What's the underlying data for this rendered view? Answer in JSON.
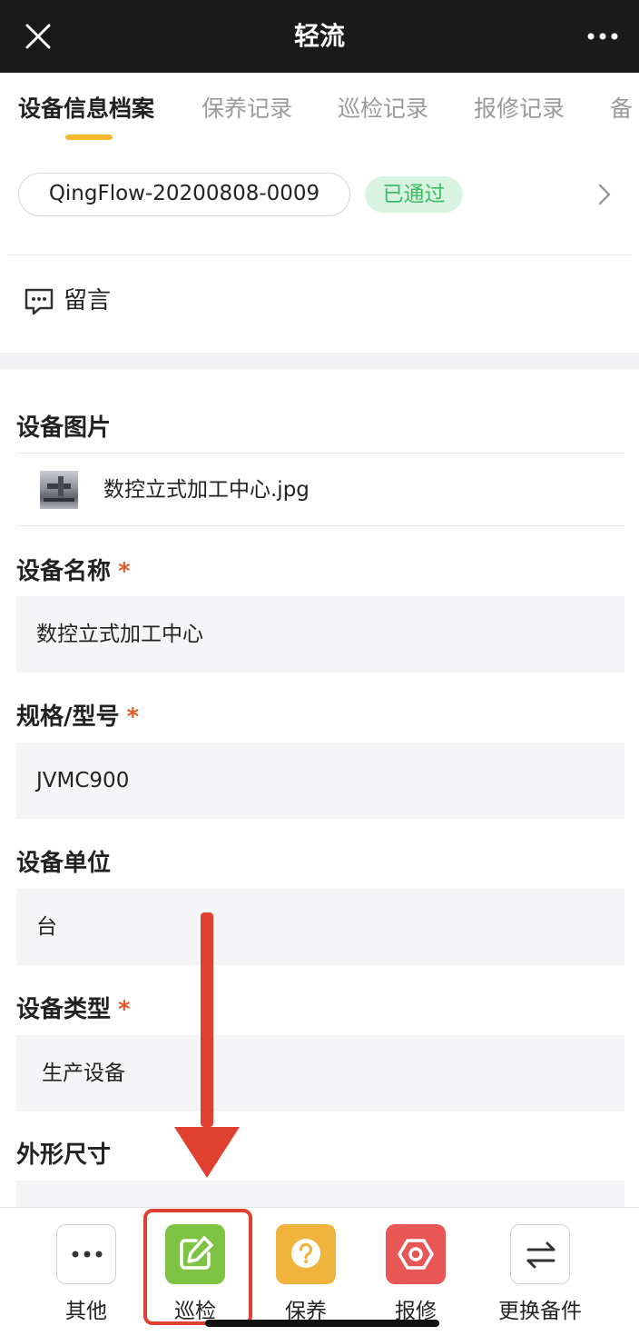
{
  "titlebar": {
    "title": "轻流"
  },
  "tabs": [
    "设备信息档案",
    "保养记录",
    "巡检记录",
    "报修记录",
    "备"
  ],
  "record": {
    "id": "QingFlow-20200808-0009",
    "status": "已通过"
  },
  "comment": {
    "label": "留言"
  },
  "form": {
    "image_label": "设备图片",
    "image_file": "数控立式加工中心.jpg",
    "name_label": "设备名称",
    "name_value": "数控立式加工中心",
    "spec_label": "规格/型号",
    "spec_value": "JVMC900",
    "unit_label": "设备单位",
    "unit_value": "台",
    "type_label": "设备类型",
    "type_value": "生产设备",
    "size_label": "外形尺寸",
    "required_mark": "*"
  },
  "bottom_actions": {
    "other": "其他",
    "inspect": "巡检",
    "maintain": "保养",
    "repair": "报修",
    "replace": "更换备件"
  },
  "colors": {
    "accent_yellow": "#f5b82e",
    "status_green": "#3dbb63",
    "inspect_green": "#7dc243",
    "maintain_yellow": "#f0b43c",
    "repair_red": "#e85656",
    "annotation_red": "#e0402f"
  }
}
